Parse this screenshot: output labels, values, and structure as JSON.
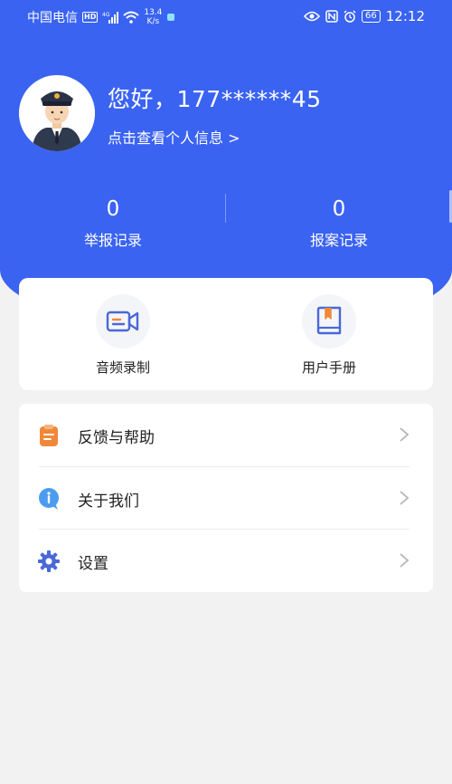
{
  "status_bar": {
    "carrier": "中国电信",
    "hd": "HD",
    "network": "4G",
    "speed_value": "13.4",
    "speed_unit": "K/s",
    "battery": "66",
    "time": "12:12"
  },
  "profile": {
    "greeting": "您好，177******45",
    "link": "点击查看个人信息 >"
  },
  "stats": {
    "report_count": "0",
    "report_label": "举报记录",
    "case_count": "0",
    "case_label": "报案记录"
  },
  "quick_actions": [
    {
      "label": "音频录制",
      "icon": "video-camera-icon"
    },
    {
      "label": "用户手册",
      "icon": "book-icon"
    }
  ],
  "menu": [
    {
      "label": "反馈与帮助",
      "icon": "clipboard-icon"
    },
    {
      "label": "关于我们",
      "icon": "info-bubble-icon"
    },
    {
      "label": "设置",
      "icon": "gear-icon"
    }
  ],
  "colors": {
    "primary": "#3a63f2",
    "background": "#f2f2f3",
    "feedback_icon": "#f0883a",
    "about_icon": "#4b9cf0",
    "settings_icon": "#4a68d8"
  }
}
